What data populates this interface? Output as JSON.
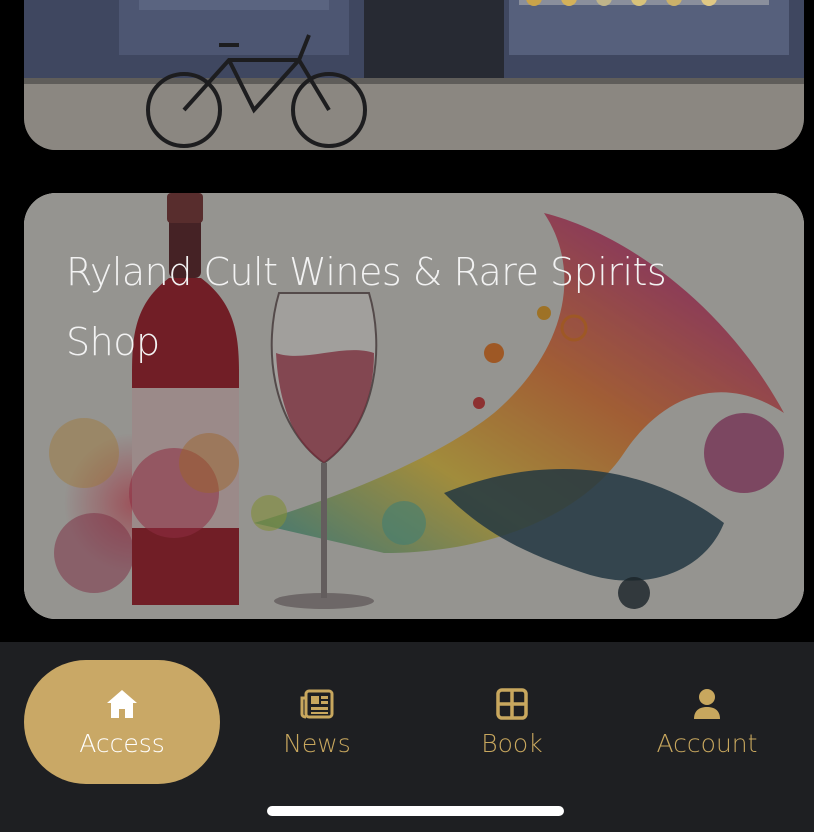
{
  "cards": {
    "top": {
      "image": "storefront-with-bicycle"
    },
    "shop": {
      "title_line1": "Ryland Cult Wines & Rare Spirits",
      "title_line2": "Shop",
      "image": "watercolor-wine-bottle-and-glass"
    }
  },
  "nav": {
    "items": [
      {
        "label": "Access",
        "icon": "home-icon",
        "active": true
      },
      {
        "label": "News",
        "icon": "newspaper-icon",
        "active": false
      },
      {
        "label": "Book",
        "icon": "grid-icon",
        "active": false
      },
      {
        "label": "Account",
        "icon": "person-icon",
        "active": false
      }
    ]
  },
  "colors": {
    "accent": "#c9a866",
    "nav_background": "#1e1f22",
    "background": "#000000"
  }
}
